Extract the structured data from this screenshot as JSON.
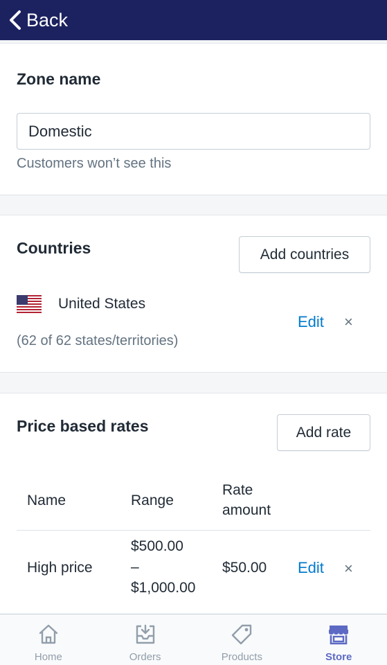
{
  "header": {
    "back_label": "Back"
  },
  "zone": {
    "title": "Zone name",
    "name_value": "Domestic",
    "help_text": "Customers won’t see this"
  },
  "countries": {
    "title": "Countries",
    "add_button": "Add countries",
    "items": [
      {
        "name": "United States",
        "detail": "(62 of 62 states/territories)",
        "edit_label": "Edit",
        "remove_label": "×"
      }
    ]
  },
  "rates": {
    "title": "Price based rates",
    "add_button": "Add rate",
    "columns": {
      "name": "Name",
      "range": "Range",
      "rate_line1": "Rate",
      "rate_line2": "amount"
    },
    "rows": [
      {
        "name": "High price",
        "range_from": "$500.00",
        "range_dash": "–",
        "range_to": "$1,000.00",
        "amount": "$50.00",
        "edit_label": "Edit",
        "remove_label": "×"
      }
    ]
  },
  "tabs": [
    {
      "label": "Home",
      "icon": "home-icon",
      "active": false
    },
    {
      "label": "Orders",
      "icon": "orders-icon",
      "active": false
    },
    {
      "label": "Products",
      "icon": "tag-icon",
      "active": false
    },
    {
      "label": "Store",
      "icon": "store-icon",
      "active": true
    }
  ],
  "colors": {
    "header_bg": "#1c2260",
    "link": "#007ace",
    "active_tab": "#5c6ac4"
  }
}
